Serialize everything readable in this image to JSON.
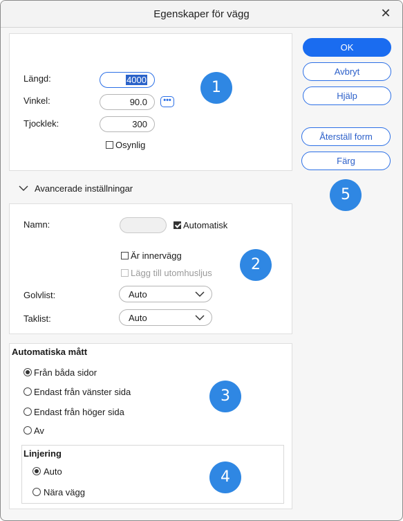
{
  "window": {
    "title": "Egenskaper för vägg"
  },
  "dimensions": {
    "length_label": "Längd:",
    "length_value": "4000",
    "angle_label": "Vinkel:",
    "angle_value": "90.0",
    "angle_more": "•••",
    "thickness_label": "Tjocklek:",
    "thickness_value": "300",
    "invisible_label": "Osynlig"
  },
  "advanced": {
    "toggle_label": "Avancerade inställningar",
    "name_label": "Namn:",
    "name_value": "",
    "automatic_label": "Automatisk",
    "inner_wall_label": "Är innervägg",
    "outdoor_light_label": "Lägg till utomhusljus",
    "skirting_label": "Golvlist:",
    "skirting_value": "Auto",
    "ceiling_label": "Taklist:",
    "ceiling_value": "Auto"
  },
  "auto_dimensions": {
    "heading": "Automatiska mått",
    "options": [
      "Från båda sidor",
      "Endast från vänster sida",
      "Endast från höger sida",
      "Av"
    ],
    "selected": "Från båda sidor"
  },
  "alignment": {
    "heading": "Linjering",
    "options": [
      "Auto",
      "Nära vägg"
    ],
    "selected": "Auto"
  },
  "buttons": {
    "ok": "OK",
    "cancel": "Avbryt",
    "help": "Hjälp",
    "reset_shape": "Återställ form",
    "color": "Färg"
  },
  "badges": [
    "1",
    "2",
    "3",
    "4",
    "5"
  ],
  "colors": {
    "accent": "#1a6cf0",
    "badge": "#2f87e3"
  },
  "icons": {
    "close": "close-icon",
    "chevron": "chevron-down-icon",
    "more": "more-dots-icon"
  }
}
